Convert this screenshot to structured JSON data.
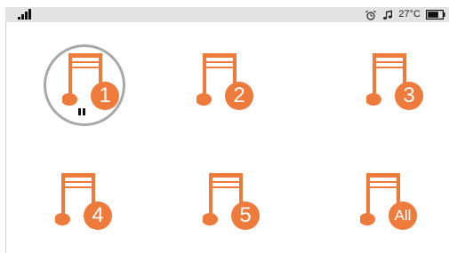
{
  "status": {
    "signal_icon": "signal-bars-icon",
    "alarm_icon": "alarm-icon",
    "music_icon": "music-note-icon",
    "temperature": "27°C",
    "battery_icon": "battery-icon",
    "battery_level": 0.75
  },
  "tiles": [
    {
      "label": "1",
      "selected": true,
      "state_icon": "pause-icon"
    },
    {
      "label": "2"
    },
    {
      "label": "3"
    },
    {
      "label": "4"
    },
    {
      "label": "5"
    },
    {
      "label": "All"
    }
  ],
  "colors": {
    "accent": "#ee7a3c",
    "status_bar": "#e3e3e3",
    "selection_ring": "#a8a8a8"
  }
}
